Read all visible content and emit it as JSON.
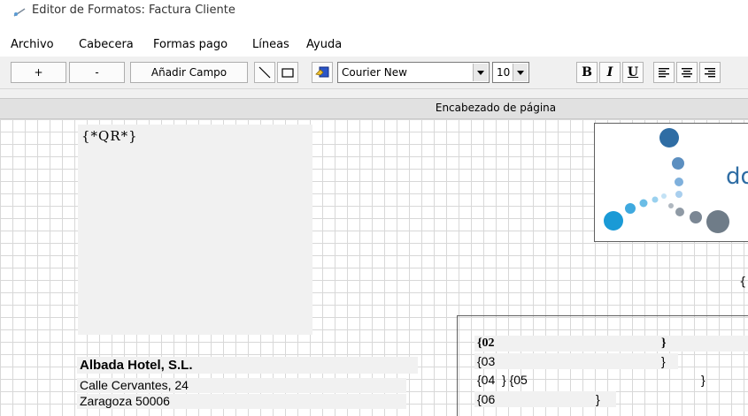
{
  "window": {
    "title": "Editor de Formatos: Factura Cliente",
    "icon": "editor-app-icon"
  },
  "menu": [
    "Archivo",
    "Cabecera",
    "Formas pago",
    "Líneas",
    "Ayuda"
  ],
  "toolbar": {
    "add_label": "+",
    "remove_label": "-",
    "add_field_label": "Añadir Campo",
    "font_name": "Courier New",
    "font_size": "10",
    "bold_label": "B",
    "italic_label": "I",
    "underline_label": "U",
    "icons": [
      "line-tool-icon",
      "rectangle-tool-icon",
      "image-tool-icon",
      "align-left-icon",
      "align-center-icon",
      "align-right-icon"
    ]
  },
  "section": {
    "title": "Encabezado de página"
  },
  "canvas": {
    "qr_field": "{*QR*}",
    "brace_right": "{",
    "address": {
      "name": "Albada Hotel, S.L.",
      "lines": [
        "Calle Cervantes, 24",
        "Zaragoza 50006"
      ]
    },
    "fields": [
      {
        "left": "{02",
        "right": "}"
      },
      {
        "left": "{03",
        "right": "}"
      },
      {
        "left": "{04  } {05",
        "right": "}"
      },
      {
        "left": "{06",
        "right": "}"
      }
    ]
  },
  "colors": {
    "logo_blue_dark": "#2f6da4",
    "logo_blue_light": "#1a9ad6",
    "logo_gray": "#6f7c88",
    "grid": "#d8d8d8"
  }
}
